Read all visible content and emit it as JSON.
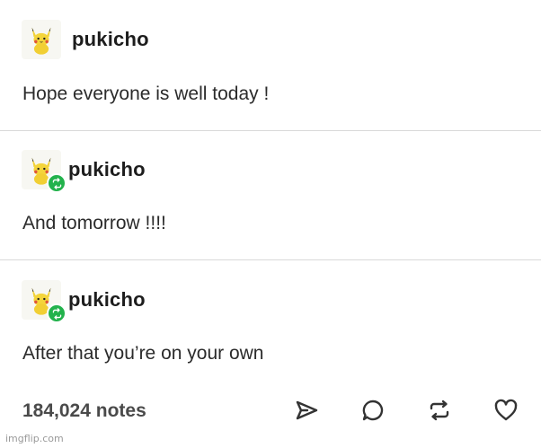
{
  "posts": [
    {
      "username": "pukicho",
      "text": "Hope everyone is well today !",
      "avatar_icon": "pikachu-avatar-icon",
      "reblog": false
    },
    {
      "username": "pukicho",
      "text": "And tomorrow !!!!",
      "avatar_icon": "pikachu-avatar-icon",
      "reblog": true
    },
    {
      "username": "pukicho",
      "text": "After that you’re on your own",
      "avatar_icon": "pikachu-avatar-icon",
      "reblog": true
    }
  ],
  "footer": {
    "notes": "184,024 notes",
    "actions": [
      "share-icon",
      "reply-icon",
      "reblog-icon",
      "like-icon"
    ]
  },
  "watermark": "imgflip.com",
  "colors": {
    "reblog_badge": "#22b24c",
    "divider": "#d9d9d9",
    "text": "#2b2b2b"
  }
}
